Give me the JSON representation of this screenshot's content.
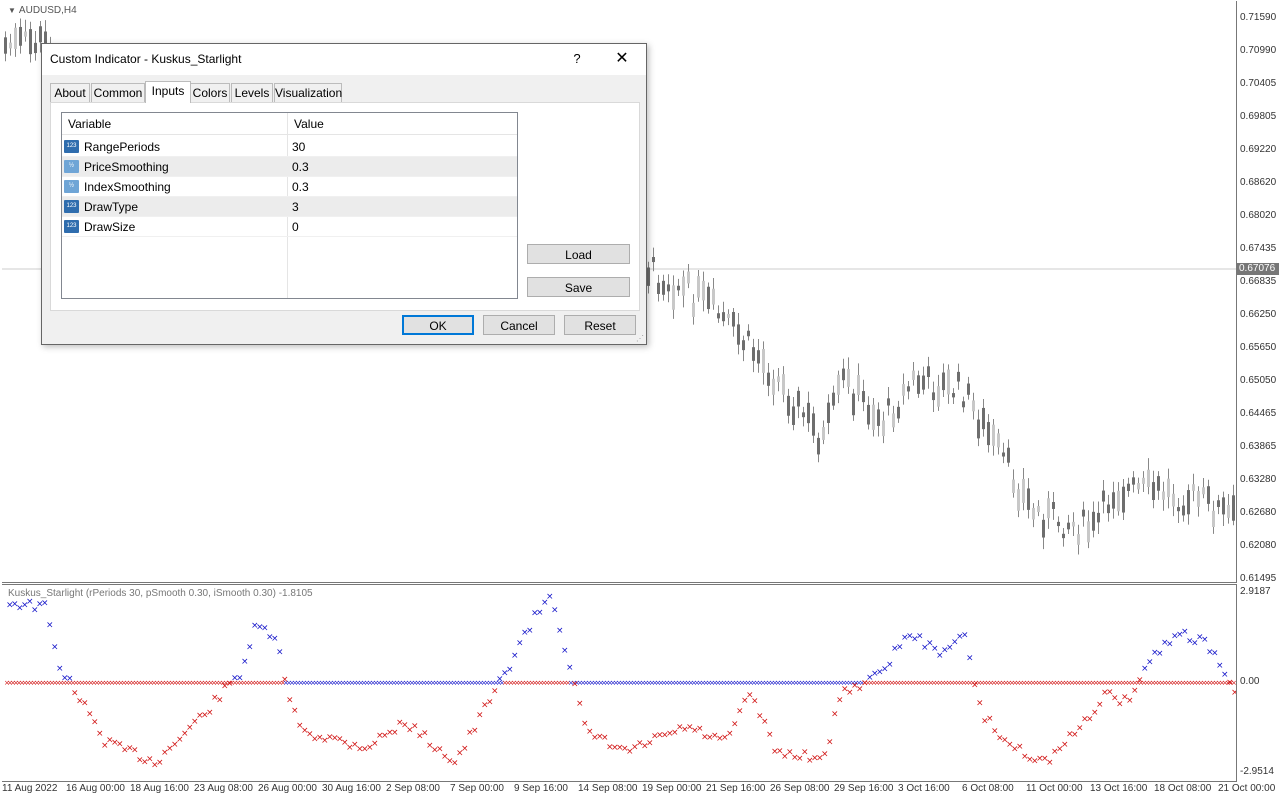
{
  "chart": {
    "symbol_label": "AUDUSD,H4",
    "current_price": "0.67076",
    "price_ticks": [
      "0.71590",
      "0.70990",
      "0.70405",
      "0.69805",
      "0.69220",
      "0.68620",
      "0.68020",
      "0.67435",
      "0.66835",
      "0.66250",
      "0.65650",
      "0.65050",
      "0.64465",
      "0.63865",
      "0.63280",
      "0.62680",
      "0.62080",
      "0.61495"
    ],
    "time_ticks": [
      "11 Aug 2022",
      "16 Aug 00:00",
      "18 Aug 16:00",
      "23 Aug 08:00",
      "26 Aug 00:00",
      "30 Aug 16:00",
      "2 Sep 08:00",
      "7 Sep 00:00",
      "9 Sep 16:00",
      "14 Sep 08:00",
      "19 Sep 00:00",
      "21 Sep 16:00",
      "26 Sep 08:00",
      "29 Sep 16:00",
      "3 Oct 16:00",
      "6 Oct 08:00",
      "11 Oct 00:00",
      "13 Oct 16:00",
      "18 Oct 08:00",
      "21 Oct 00:00"
    ]
  },
  "indicator": {
    "title": "Kuskus_Starlight  (rPeriods 30, pSmooth 0.30, iSmooth 0.30)  -1.8105",
    "scale_max": "2.9187",
    "scale_zero": "0.00",
    "scale_min": "-2.9514",
    "colors": {
      "positive": "#1010c8",
      "negative": "#d01010"
    }
  },
  "dialog": {
    "title": "Custom Indicator - Kuskus_Starlight",
    "help_label": "?",
    "close_label": "✕",
    "tabs": [
      "About",
      "Common",
      "Inputs",
      "Colors",
      "Levels",
      "Visualization"
    ],
    "active_tab": "Inputs",
    "grid": {
      "headers": {
        "variable": "Variable",
        "value": "Value"
      },
      "rows": [
        {
          "icon": "123",
          "name": "RangePeriods",
          "value": "30"
        },
        {
          "icon": "½",
          "name": "PriceSmoothing",
          "value": "0.3"
        },
        {
          "icon": "½",
          "name": "IndexSmoothing",
          "value": "0.3"
        },
        {
          "icon": "123",
          "name": "DrawType",
          "value": "3"
        },
        {
          "icon": "123",
          "name": "DrawSize",
          "value": "0"
        }
      ]
    },
    "buttons": {
      "load": "Load",
      "save": "Save",
      "ok": "OK",
      "cancel": "Cancel",
      "reset": "Reset"
    }
  }
}
